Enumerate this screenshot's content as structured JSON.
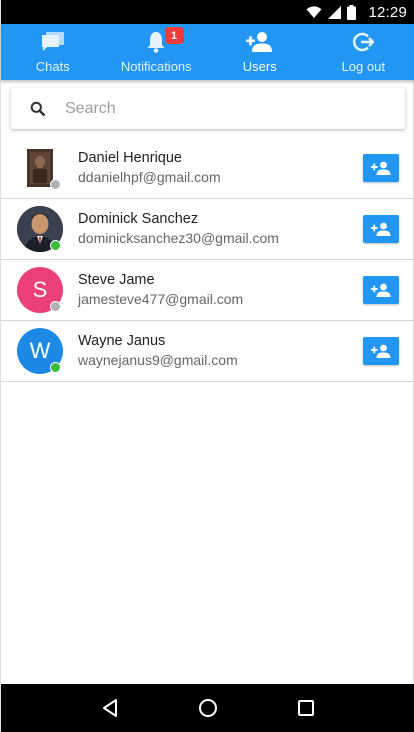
{
  "status_bar": {
    "time": "12:29"
  },
  "tabs": [
    {
      "label": "Chats",
      "icon": "chat-icon"
    },
    {
      "label": "Notifications",
      "icon": "bell-icon",
      "badge": "1"
    },
    {
      "label": "Users",
      "icon": "person-add-icon"
    },
    {
      "label": "Log out",
      "icon": "logout-icon"
    }
  ],
  "search": {
    "placeholder": "Search",
    "value": ""
  },
  "users": [
    {
      "name": "Daniel Henrique",
      "email": "ddanielhpf@gmail.com",
      "avatar_letter": "",
      "avatar_color": "#3a2a22",
      "online": false
    },
    {
      "name": "Dominick Sanchez",
      "email": "dominicksanchez30@gmail.com",
      "avatar_letter": "",
      "avatar_color": "#2b2f3a",
      "online": true
    },
    {
      "name": "Steve Jame",
      "email": "jamesteve477@gmail.com",
      "avatar_letter": "S",
      "avatar_color": "#ec407a",
      "online": false
    },
    {
      "name": "Wayne Janus",
      "email": "waynejanus9@gmail.com",
      "avatar_letter": "W",
      "avatar_color": "#1e88e5",
      "online": true
    }
  ],
  "colors": {
    "primary": "#2196f3",
    "badge": "#ef3b3b",
    "online": "#3dbb3d",
    "offline": "#b0b0b0"
  }
}
